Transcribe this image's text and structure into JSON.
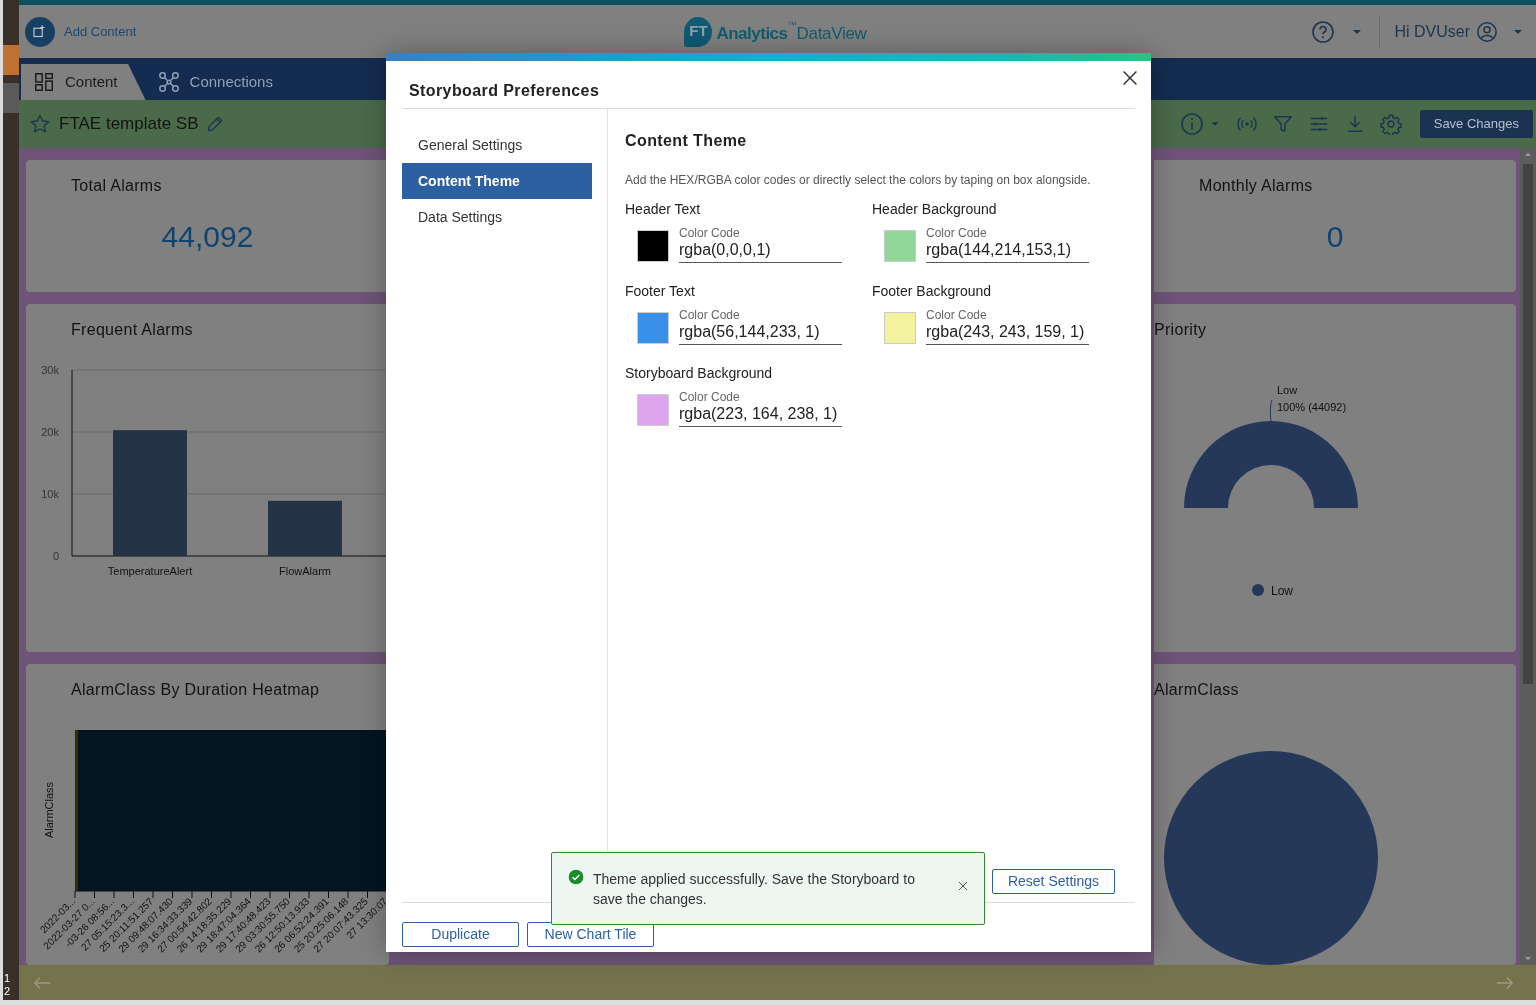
{
  "app_header": {
    "add_content": "Add Content",
    "logo": {
      "mark": "FT",
      "name": "Analytics",
      "tm": "™",
      "product": "DataView"
    },
    "greeting": "Hi DVUser"
  },
  "tabs": [
    {
      "label": "Content",
      "selected": true
    },
    {
      "label": "Connections",
      "selected": false
    }
  ],
  "toolbar": {
    "title": "FTAE template SB",
    "favorite": false,
    "save_button": "Save Changes"
  },
  "tiles": {
    "total_alarms": {
      "title": "Total Alarms",
      "value": "44,092"
    },
    "monthly_alarms": {
      "title": "Monthly Alarms",
      "value": "0"
    },
    "frequent_alarms": {
      "title": "Frequent Alarms",
      "chart_data": {
        "type": "bar",
        "categories": [
          "TemperatureAlert",
          "FlowAlarm"
        ],
        "values": [
          20300,
          8900
        ],
        "ylim": [
          0,
          30000
        ],
        "yticks": [
          {
            "value": 0,
            "label": "0"
          },
          {
            "value": 10000,
            "label": "10k"
          },
          {
            "value": 20000,
            "label": "20k"
          },
          {
            "value": 30000,
            "label": "30k"
          }
        ]
      }
    },
    "priority": {
      "title": "Priority",
      "slice_label": "Low",
      "slice_value": "100% (44092)",
      "legend": [
        {
          "label": "Low",
          "color": "#25385a"
        }
      ]
    },
    "heatmap": {
      "title": "AlarmClass By Duration Heatmap",
      "y_axis_label": "AlarmClass",
      "x_labels": [
        "2022-03...",
        "2022-03-27 0...",
        "-03-26 08:56...",
        "27 05:15:23.3...",
        "25 20:11:51.257",
        "29 09:48:07.430",
        "29 16:34:33.339",
        "27 00:54:42.802",
        "26 14:18:35.229",
        "29 18:47:04.364",
        "29 17:40:48.423",
        "29 03:30:55.750",
        "26 12:50:13.933",
        "26 06:52:24.391",
        "25 20:25:06.148",
        "27 20:07:43.325",
        "27 13:30:07"
      ]
    },
    "alarm_class": {
      "title": "AlarmClass"
    }
  },
  "page_markers": [
    "1",
    "2"
  ],
  "dialog": {
    "title": "Storyboard Preferences",
    "nav": [
      {
        "label": "General Settings",
        "selected": false
      },
      {
        "label": "Content Theme",
        "selected": true
      },
      {
        "label": "Data Settings",
        "selected": false
      }
    ],
    "heading": "Content Theme",
    "description": "Add the HEX/RGBA color codes or directly select the colors by taping on box alongside.",
    "fields": [
      {
        "label": "Header Text",
        "caption": "Color Code",
        "value": "rgba(0,0,0,1)",
        "color": "#000000"
      },
      {
        "label": "Header Background",
        "caption": "Color Code",
        "value": "rgba(144,214,153,1)",
        "color": "#90d699"
      },
      {
        "label": "Footer Text",
        "caption": "Color Code",
        "value": "rgba(56,144,233, 1)",
        "color": "#3890e9"
      },
      {
        "label": "Footer Background",
        "caption": "Color Code",
        "value": "rgba(243, 243, 159, 1)",
        "color": "#f3f39f"
      },
      {
        "label": "Storyboard Background",
        "caption": "Color Code",
        "value": "rgba(223, 164, 238, 1)",
        "color": "#dfa4ee"
      }
    ],
    "reset_button": "Reset Settings",
    "footer_buttons": [
      "Duplicate",
      "New Chart Tile"
    ]
  },
  "toast": {
    "kind": "success",
    "message": "Theme applied successfully. Save the Storyboard to save the changes."
  }
}
